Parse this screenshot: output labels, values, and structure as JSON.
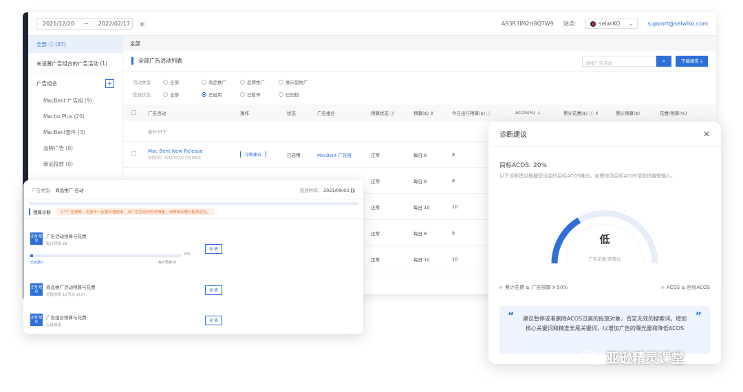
{
  "topbar": {
    "date_start": "2021/12/20",
    "date_sep": "~",
    "date_end": "2022/02/17",
    "account_id": "A93R3IM2H8QTW9",
    "store_label": "站点:",
    "store_value": "selwiKO",
    "email": "support@selwiko.com"
  },
  "sidebar": {
    "all_label": "全部 ⓘ (37)",
    "ungrouped": "未设置广告组合的广告活动 (1)",
    "group_header": "广告组合",
    "items": [
      "MacBent 广告组 (9)",
      "Macbo Plus (20)",
      "MacBent套件 (3)",
      "品牌广告 (0)",
      "新品投放 (0)"
    ]
  },
  "content": {
    "crumb": "全部",
    "list_title": "全部广告活动列表",
    "search_placeholder": "请搜广告活动",
    "download_btn": "下载报告 ⤓",
    "filter1_label": "活动类型",
    "filter1_opts": [
      "全部",
      "商品推广",
      "品牌推广",
      "展示型推广"
    ],
    "filter2_label": "投放状态",
    "filter2_opts": [
      "全部",
      "已启用",
      "已暂停",
      "已归档"
    ],
    "headers": [
      "广告活动",
      "操作",
      "状态",
      "广告组合",
      "预算状态 ⓘ",
      "预算($) ↕",
      "今日出行预算($) ⓘ",
      "ACOS(%) ↓",
      "累计花费($) ⓘ ↕",
      "累计预算($)",
      "花费/预算(%)"
    ],
    "total": "合计37个",
    "row1": {
      "name": "Mac Bent New Release",
      "meta": "投放时间: 2021/09/03 已投放6周",
      "action": "诊断建议",
      "status": "已启用",
      "portfolio": "MacBent 广告组",
      "budget_status": "正常",
      "budget": "每日 8",
      "today": "8"
    },
    "rows": [
      {
        "budget_status": "正常",
        "budget": "每日 8",
        "today": "8"
      },
      {
        "budget_status": "正常",
        "budget": "每日 10",
        "today": "10"
      },
      {
        "budget_status": "正常",
        "budget": "每日 8",
        "today": "8"
      },
      {
        "budget_status": "正常",
        "budget": "每日 10",
        "today": "10"
      }
    ]
  },
  "float_left": {
    "label_type": "广告类型:",
    "type_value": "商品推广-自动",
    "label_time": "投放时间:",
    "time_value": "2021/09/03 起",
    "section": "预算诊断",
    "warning": "1个广告预算、花费不一定被合理使用。点广告活动的的详情看，请预算合理分配到定位。",
    "items": [
      {
        "tag": "正常 建议",
        "title": "广告活动预算与花费",
        "sub": "每日预算 $8",
        "progress_label_left": "已花费0",
        "progress_label_right": "每日预算$8",
        "pct": "0%",
        "btn": "详 情"
      },
      {
        "tag": "正常 建议",
        "title": "商品推广活动预算与花费",
        "sub": "总投放费 12活动 $107",
        "btn": "详 情"
      },
      {
        "tag": "正常 建议",
        "title": "广告组合预算与花费",
        "sub": "无投放组",
        "btn": "详 情"
      }
    ],
    "progress_pct": 0.02
  },
  "diagnosis": {
    "title": "诊断建议",
    "target": "目标ACOS: 20%",
    "desc": "以下诊断建议根据您设定的目标ACOS推出，如需修改目标ACOS请前往编辑输入。",
    "level": "低",
    "gauge_label": "广告花费/预算比",
    "gauge_fraction": 0.33,
    "legend_left": "累计花费 ≥ 广告预算 X 50%",
    "legend_right": "ACOS ≥ 目标ACOS",
    "advice": "建议暂停或者删除ACOS过高的投放对象，否定无效的搜索词，增加核心关键词和精准长尾关键词，以增加广告的曝光量和降低ACOS",
    "color_accent": "#2f6fd8"
  },
  "watermark": {
    "text": "亚逊精灵课堂"
  }
}
